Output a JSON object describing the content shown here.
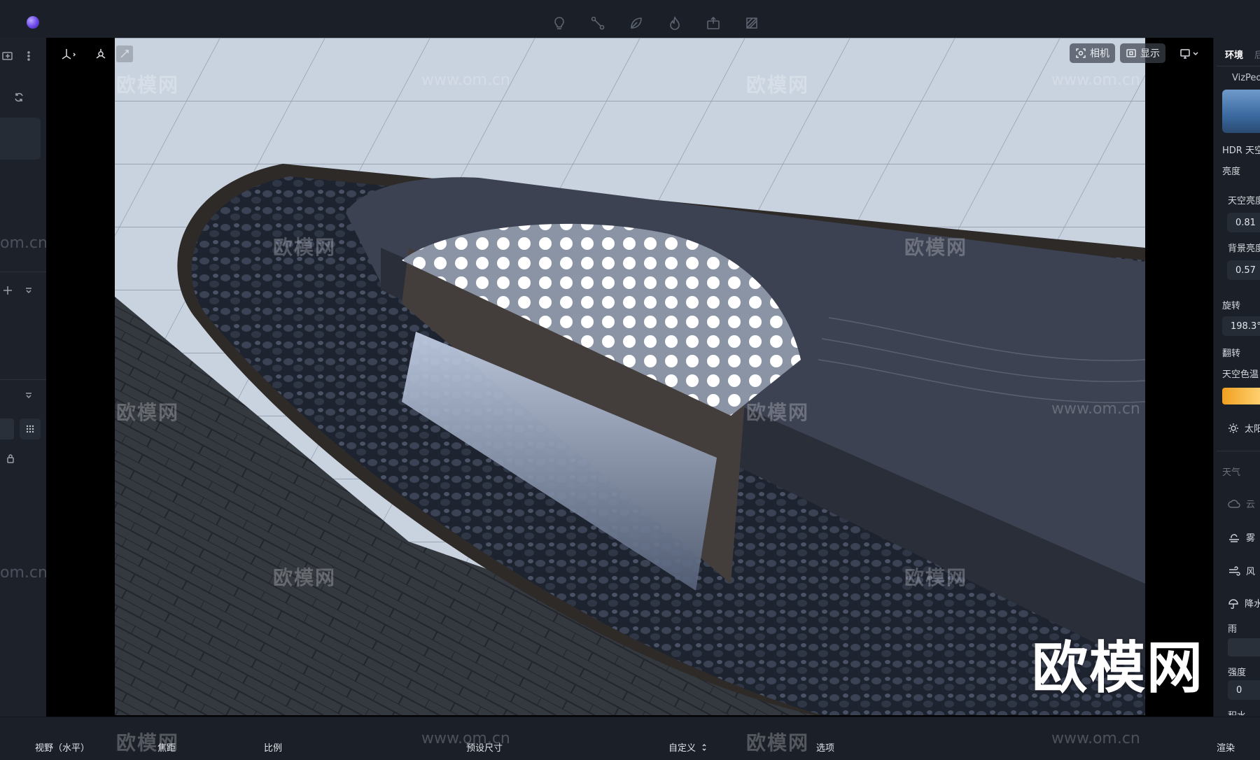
{
  "top_toolbar": {
    "tools": [
      "light-bulb-icon",
      "path-icon",
      "leaf-icon",
      "flame-icon",
      "export-icon",
      "hatch-icon"
    ]
  },
  "viewport": {
    "camera_label": "相机",
    "display_label": "显示",
    "watermark_text": "欧模网",
    "watermark_url": "www.om.cn",
    "watermark_partial_url": "om.cn",
    "big_watermark": "欧模网"
  },
  "right_panel": {
    "tab_active": "环境",
    "tab_next": "后",
    "preset_name": "VizPeo",
    "hdr_label": "HDR 天空",
    "brightness_label": "亮度",
    "sky_brightness_label": "天空亮度",
    "sky_brightness_value": "0.81",
    "bg_brightness_label": "背景亮度",
    "bg_brightness_value": "0.57",
    "rotation_label": "旋转",
    "rotation_value": "198.3°",
    "flip_label": "翻转",
    "sky_color_temp_label": "天空色温",
    "sun_label": "太阳",
    "weather_label": "天气",
    "cloud_label": "云",
    "fog_label": "雾",
    "wind_label": "风",
    "precip_label": "降水",
    "rain_label": "雨",
    "intensity_label": "强度",
    "intensity_value": "0",
    "accumulation_label": "积水",
    "colors": {
      "temp_gradient_start": "#f0a020",
      "temp_gradient_end": "#ffd070"
    }
  },
  "bottom_bar": {
    "fov_label": "视野（水平）",
    "focal_label": "焦距",
    "ratio_label": "比例",
    "preset_size_label": "预设尺寸",
    "custom_label": "自定义",
    "options_label": "选项",
    "render_label": "渲染"
  }
}
